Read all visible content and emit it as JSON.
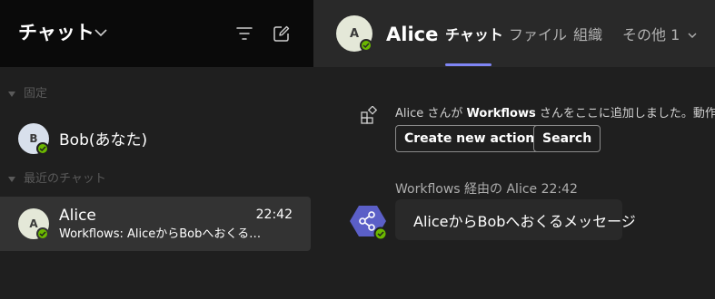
{
  "left_panel": {
    "title": "チャット",
    "sections": {
      "pinned": "固定",
      "recent": "最近のチャット"
    },
    "pinned_chat": {
      "avatar_initial": "B",
      "name": "Bob(あなた)"
    },
    "recent_chat": {
      "avatar_initial": "A",
      "name": "Alice",
      "time": "22:42",
      "preview": "Workflows: AliceからBobへおくるメッセージ"
    },
    "icons": {
      "filter": "filter-icon",
      "new_chat": "compose-icon"
    }
  },
  "conversation": {
    "avatar_initial": "A",
    "name": "Alice",
    "tabs": [
      {
        "label": "チャット",
        "active": true
      },
      {
        "label": "ファイル",
        "active": false
      },
      {
        "label": "組織",
        "active": false
      },
      {
        "label": "その他 1",
        "active": false
      }
    ],
    "system_message": {
      "prefix": "Alice さんが ",
      "app": "Workflows",
      "suffix": " さんをここに追加しました。動作を確"
    },
    "actions": {
      "create": "Create new action",
      "search": "Search"
    },
    "message": {
      "meta": "Workflows 経由の Alice   22:42",
      "text": "AliceからBobへおくるメッセージ"
    }
  },
  "colors": {
    "accent": "#7f85f5",
    "presence": "#6bb700",
    "workflow_hex": "#5b5fc7"
  }
}
